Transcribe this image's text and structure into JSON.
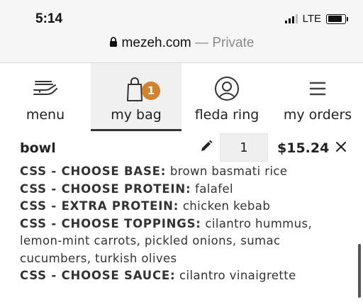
{
  "status_bar": {
    "time": "5:14",
    "network": "LTE"
  },
  "browser": {
    "domain": "mezeh.com",
    "separator": " — ",
    "mode": "Private"
  },
  "nav": {
    "items": [
      {
        "label": "menu",
        "icon": "hand-plate-icon"
      },
      {
        "label": "my bag",
        "icon": "shopping-bag-icon",
        "badge": "1",
        "active": true
      },
      {
        "label": "fleda ring",
        "icon": "user-circle-icon"
      },
      {
        "label": "my orders",
        "icon": "list-icon"
      }
    ]
  },
  "cart": {
    "item": {
      "name": "bowl",
      "quantity": "1",
      "price": "$15.24",
      "options": [
        {
          "key": "CSS - CHOOSE BASE:",
          "value": "brown basmati rice"
        },
        {
          "key": "CSS - CHOOSE PROTEIN:",
          "value": "falafel"
        },
        {
          "key": "CSS - EXTRA PROTEIN:",
          "value": "chicken kebab"
        },
        {
          "key": "CSS - CHOOSE TOPPINGS:",
          "value": "cilantro hummus, lemon-mint carrots, pickled onions, sumac cucumbers, turkish olives"
        },
        {
          "key": "CSS - CHOOSE SAUCE:",
          "value": "cilantro vinaigrette"
        }
      ]
    }
  },
  "colors": {
    "badge": "#d2822d",
    "active_tab_bg": "#f0f0f0"
  }
}
